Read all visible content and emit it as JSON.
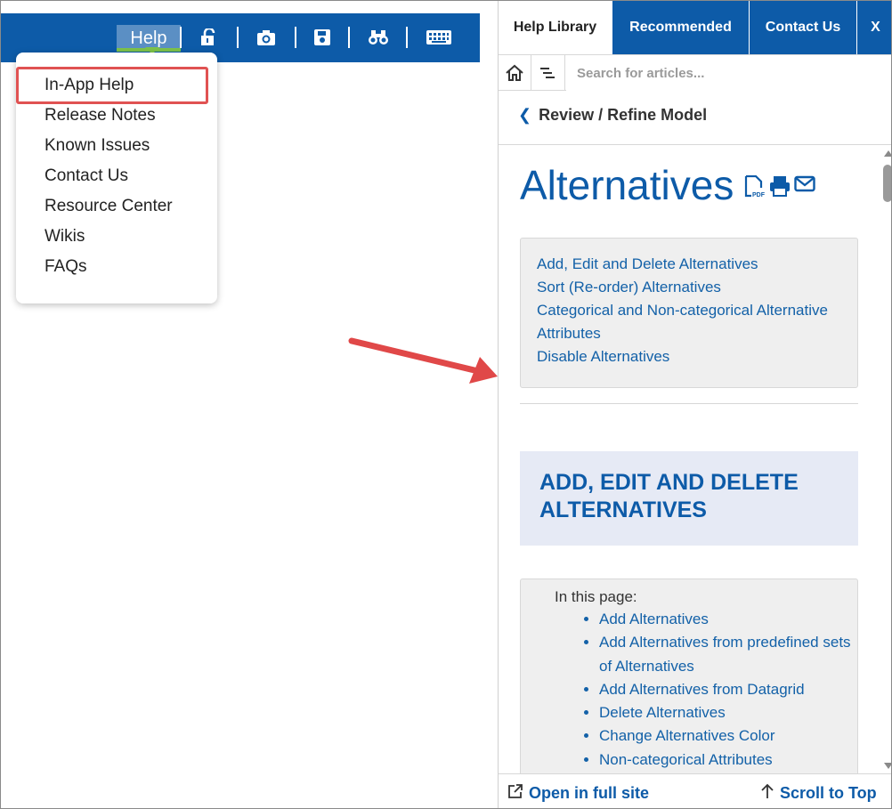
{
  "toolbar": {
    "help_label": "Help",
    "icons": [
      "unlock-icon",
      "camera-icon",
      "save-icon",
      "binoculars-icon",
      "keyboard-icon"
    ]
  },
  "help_menu": {
    "items": [
      {
        "label": "In-App Help",
        "highlighted": true
      },
      {
        "label": "Release Notes"
      },
      {
        "label": "Known Issues"
      },
      {
        "label": "Contact Us"
      },
      {
        "label": "Resource Center"
      },
      {
        "label": "Wikis"
      },
      {
        "label": "FAQs"
      }
    ]
  },
  "panel": {
    "tabs": [
      {
        "label": "Help Library",
        "active": true
      },
      {
        "label": "Recommended"
      },
      {
        "label": "Contact Us"
      },
      {
        "label": "X"
      }
    ],
    "search_placeholder": "Search for articles...",
    "breadcrumb": "Review / Refine Model",
    "title": "Alternatives",
    "toc": [
      "Add, Edit and Delete Alternatives",
      "Sort (Re-order) Alternatives",
      "Categorical and Non-categorical Alternative Attributes",
      "Disable Alternatives"
    ],
    "section_heading": "ADD, EDIT AND DELETE ALTERNATIVES",
    "in_this_page_label": "In this page:",
    "in_this_page": [
      "Add Alternatives",
      "Add Alternatives from predefined sets of Alternatives",
      "Add Alternatives from Datagrid",
      "Delete Alternatives",
      "Change Alternatives Color",
      "Non-categorical Attributes"
    ],
    "footer": {
      "open_full": "Open in full site",
      "scroll_top": "Scroll to Top"
    }
  },
  "colors": {
    "brand_blue": "#0d5ba8",
    "highlight_red": "#e05252",
    "arrow_red": "#e04848",
    "help_underline": "#7dc34a"
  }
}
